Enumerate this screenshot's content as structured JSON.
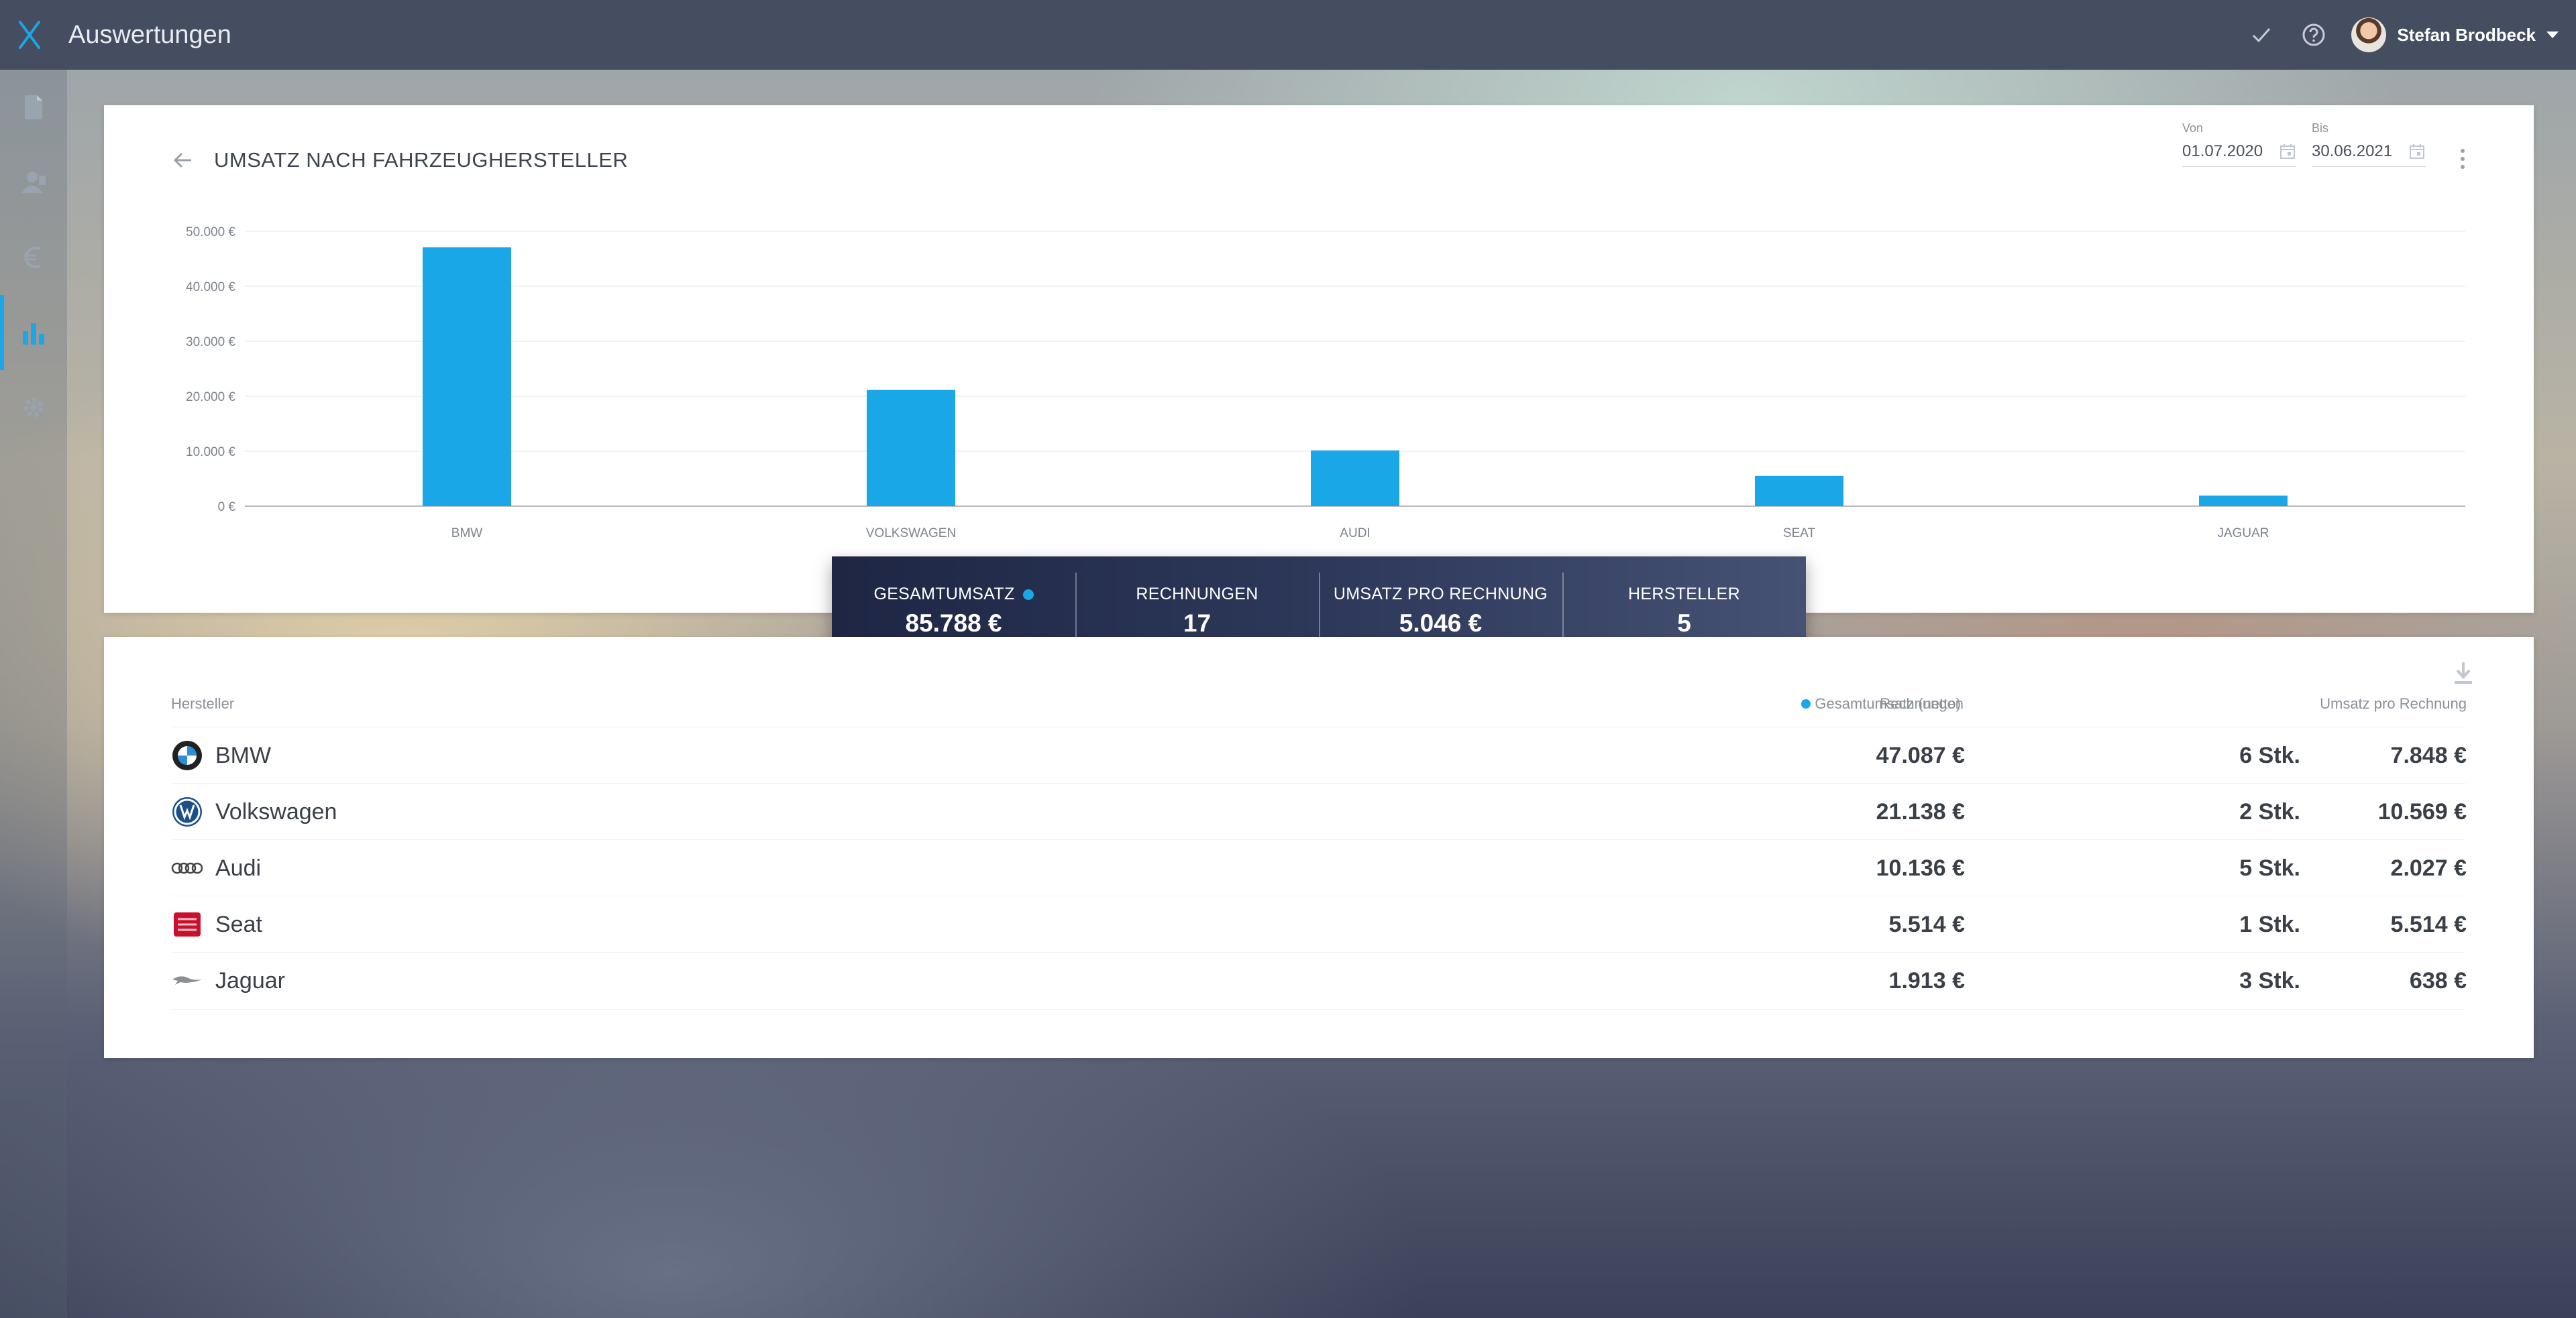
{
  "app": {
    "title": "Auswertungen",
    "accent": "#1aa7e8"
  },
  "user": {
    "name": "Stefan Brodbeck"
  },
  "top_icons": [
    "check-icon",
    "help-icon"
  ],
  "sidebar": {
    "items": [
      {
        "icon": "document-icon",
        "active": false
      },
      {
        "icon": "contacts-icon",
        "active": false
      },
      {
        "icon": "euro-icon",
        "active": false
      },
      {
        "icon": "bar-chart-icon",
        "active": true
      },
      {
        "icon": "gear-icon",
        "active": false
      }
    ]
  },
  "report": {
    "title": "UMSATZ NACH FAHRZEUGHERSTELLER",
    "from_label": "Von",
    "from_value": "01.07.2020",
    "to_label": "Bis",
    "to_value": "30.06.2021"
  },
  "chart_data": {
    "type": "bar",
    "categories": [
      "BMW",
      "VOLKSWAGEN",
      "AUDI",
      "SEAT",
      "JAGUAR"
    ],
    "values": [
      47087,
      21138,
      10136,
      5514,
      1913
    ],
    "ylim": [
      0,
      50000
    ],
    "yticks": [
      0,
      10000,
      20000,
      30000,
      40000,
      50000
    ],
    "ytick_labels": [
      "0 €",
      "10.000 €",
      "20.000 €",
      "30.000 €",
      "40.000 €",
      "50.000 €"
    ],
    "grid": true,
    "color": "#1aa7e8"
  },
  "stats": [
    {
      "label": "GESAMTUMSATZ",
      "value": "85.788 €"
    },
    {
      "label": "RECHNUNGEN",
      "value": "17"
    },
    {
      "label": "UMSATZ PRO RECHNUNG",
      "value": "5.046 €"
    },
    {
      "label": "HERSTELLER",
      "value": "5"
    }
  ],
  "table": {
    "headers": {
      "maker": "Hersteller",
      "revenue": "Gesamtumsatz (netto)",
      "invoices": "Rechnungen",
      "per_invoice": "Umsatz pro Rechnung"
    },
    "rows": [
      {
        "logo": "bmw-logo-icon",
        "name": "BMW",
        "revenue": "47.087 €",
        "invoices": "6 Stk.",
        "per_invoice": "7.848 €"
      },
      {
        "logo": "volkswagen-logo-icon",
        "name": "Volkswagen",
        "revenue": "21.138 €",
        "invoices": "2 Stk.",
        "per_invoice": "10.569 €"
      },
      {
        "logo": "audi-logo-icon",
        "name": "Audi",
        "revenue": "10.136 €",
        "invoices": "5 Stk.",
        "per_invoice": "2.027 €"
      },
      {
        "logo": "seat-logo-icon",
        "name": "Seat",
        "revenue": "5.514 €",
        "invoices": "1 Stk.",
        "per_invoice": "5.514 €"
      },
      {
        "logo": "jaguar-logo-icon",
        "name": "Jaguar",
        "revenue": "1.913 €",
        "invoices": "3 Stk.",
        "per_invoice": "638 €"
      }
    ]
  }
}
